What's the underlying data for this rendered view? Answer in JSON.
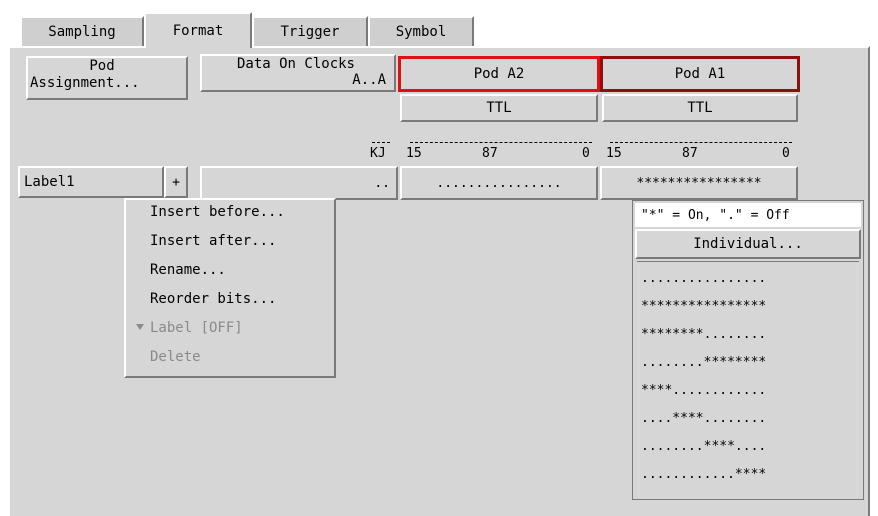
{
  "tabs": [
    {
      "label": "Sampling",
      "active": false
    },
    {
      "label": "Format",
      "active": true
    },
    {
      "label": "Trigger",
      "active": false
    },
    {
      "label": "Symbol",
      "active": false
    }
  ],
  "pod_assignment": {
    "line1": "Pod",
    "line2": "Assignment..."
  },
  "data_on_clocks": {
    "line1": "Data On Clocks",
    "line2": "A..A"
  },
  "pods": [
    {
      "name": "Pod A2",
      "threshold": "TTL",
      "border_color": "#e11010"
    },
    {
      "name": "Pod A1",
      "threshold": "TTL",
      "border_color": "#8b1010"
    }
  ],
  "clock_bits_header": "KJ",
  "pod_a2_bit_header": {
    "left": "15",
    "mid": "87",
    "right": "0"
  },
  "pod_a1_bit_header": {
    "left": "15",
    "mid": "87",
    "right": "0"
  },
  "label_row": {
    "name": "Label1",
    "plus": "+",
    "clock_bits": "..",
    "pod_a2_bits": "................",
    "pod_a1_bits": "****************"
  },
  "label_menu": {
    "items": [
      {
        "label": "Insert before...",
        "enabled": true
      },
      {
        "label": "Insert after...",
        "enabled": true
      },
      {
        "label": "Rename...",
        "enabled": true
      },
      {
        "label": "Reorder bits...",
        "enabled": true
      },
      {
        "label": "Label [OFF]",
        "enabled": false
      },
      {
        "label": "Delete",
        "enabled": false
      }
    ]
  },
  "bits_menu": {
    "legend": "\"*\" = On, \".\" = Off",
    "individual": "Individual...",
    "patterns": [
      "................",
      "****************",
      "********........",
      "........********",
      "****............",
      "....****........",
      "........****....",
      "............****"
    ]
  }
}
